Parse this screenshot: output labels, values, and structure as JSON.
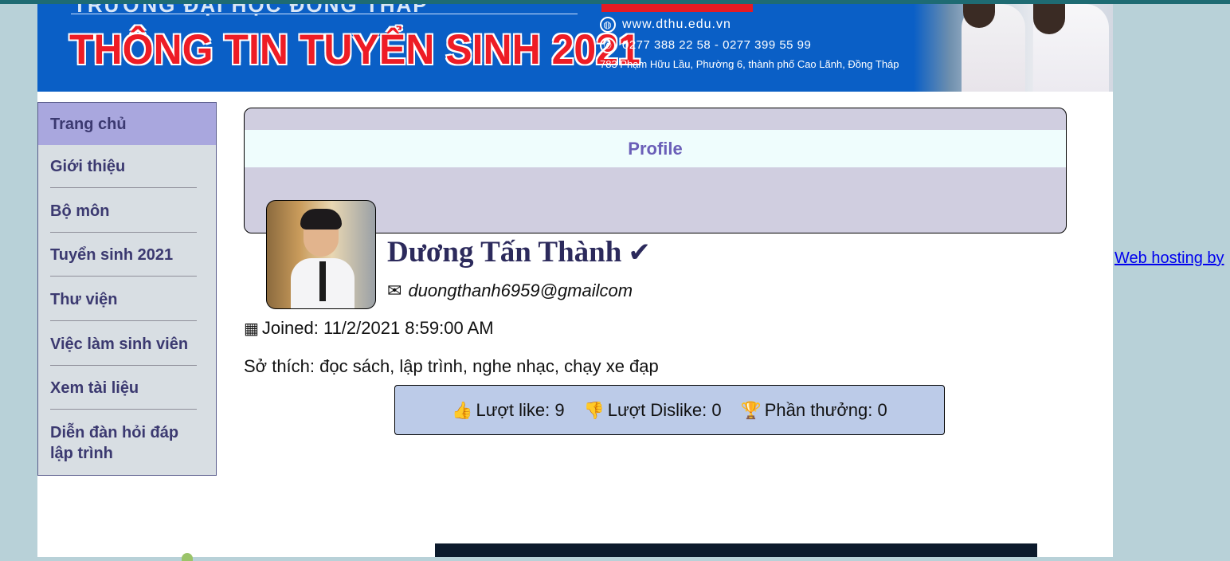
{
  "banner": {
    "school_name": "TRƯỜNG ĐẠI HỌC ĐỒNG THÁP",
    "headline": "THÔNG TIN TUYỂN SINH 2021",
    "website": "www.dthu.edu.vn",
    "phones": "0277 388 22 58  -  0277 399 55 99",
    "address": "783 Phạm Hữu Lầu, Phường 6, thành phố Cao Lãnh, Đồng Tháp"
  },
  "sidebar": {
    "items": [
      {
        "label": "Trang chủ"
      },
      {
        "label": "Giới thiệu"
      },
      {
        "label": "Bộ môn"
      },
      {
        "label": "Tuyển sinh 2021"
      },
      {
        "label": "Thư viện"
      },
      {
        "label": "Việc làm sinh viên"
      },
      {
        "label": "Xem tài liệu"
      },
      {
        "label": "Diễn đàn hỏi đáp lập trình"
      }
    ]
  },
  "profile": {
    "heading": "Profile",
    "name": "Dương Tấn Thành",
    "verified_icon": "check-icon",
    "email": "duongthanh6959@gmailcom",
    "joined": "Joined: 11/2/2021 8:59:00 AM",
    "hobbies": "Sở thích: đọc sách, lập trình, nghe nhạc, chạy xe đạp"
  },
  "stats": {
    "likes": "Lượt like: 9",
    "dislikes": "Lượt Dislike: 0",
    "rewards": "Phần thưởng: 0"
  },
  "footer": {
    "hosting_link": "Web hosting by"
  },
  "colors": {
    "banner_blue": "#0a5fc6",
    "headline_red": "#ee1c25",
    "sidebar_active": "#a9a7de",
    "profile_band": "#d0cee0",
    "stats_bg": "#bccbe8",
    "link": "#0000ee"
  }
}
